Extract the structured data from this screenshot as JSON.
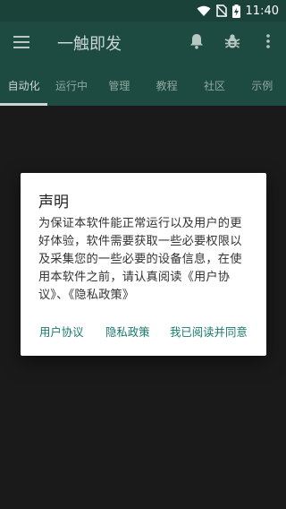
{
  "status_bar": {
    "time": "11:40",
    "icons": [
      "wifi-icon",
      "sim-off-icon",
      "battery-charging-icon"
    ]
  },
  "app_bar": {
    "title": "一触即发",
    "icons": [
      "menu-icon",
      "bell-icon",
      "bug-icon",
      "more-vert-icon"
    ]
  },
  "tabs": [
    {
      "label": "自动化",
      "active": true
    },
    {
      "label": "运行中",
      "active": false
    },
    {
      "label": "管理",
      "active": false
    },
    {
      "label": "教程",
      "active": false
    },
    {
      "label": "社区",
      "active": false
    },
    {
      "label": "示例",
      "active": false
    }
  ],
  "dialog": {
    "title": "声明",
    "body": "为保证本软件能正常运行以及用户的更好体验，软件需要获取一些必要权限以及采集您的一些必要的设备信息，在使用本软件之前，请认真阅读《用户协议》、《隐私政策》",
    "actions": {
      "user_agreement": "用户协议",
      "privacy_policy": "隐私政策",
      "agree": "我已阅读并同意"
    }
  },
  "colors": {
    "status_bar_bg": "#1b4239",
    "app_bar_bg": "#1e4b41",
    "accent": "#1a7a6e",
    "scrim_bg": "#1a1a1a"
  }
}
